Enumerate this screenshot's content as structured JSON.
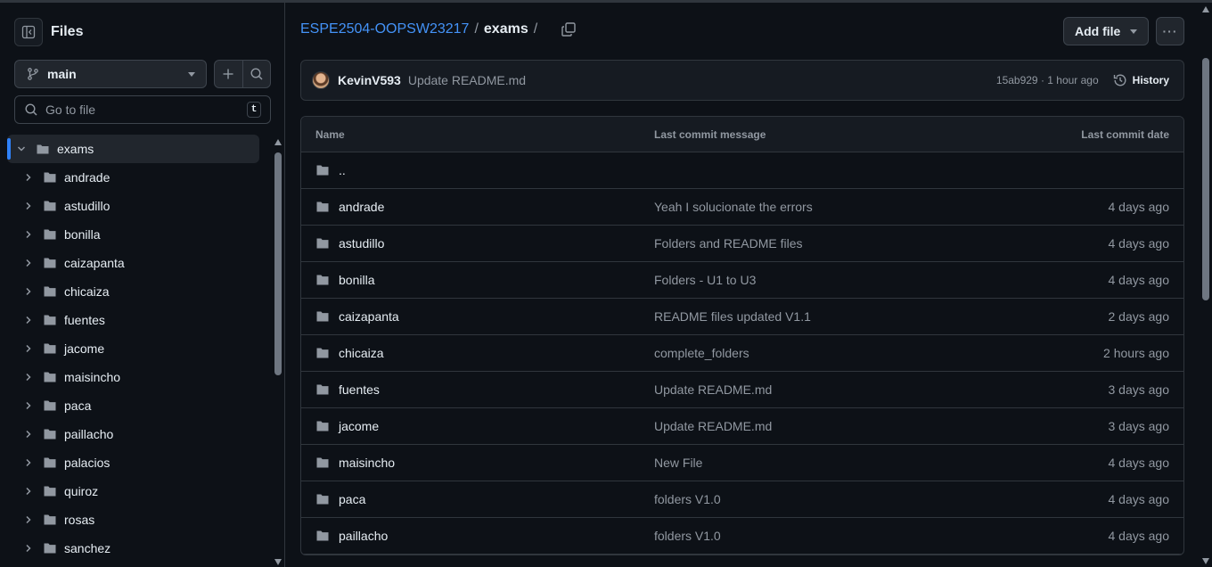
{
  "sidebar": {
    "title": "Files",
    "branch": "main",
    "goto_placeholder": "Go to file",
    "goto_shortcut": "t",
    "root_folder": "exams",
    "folders": [
      "andrade",
      "astudillo",
      "bonilla",
      "caizapanta",
      "chicaiza",
      "fuentes",
      "jacome",
      "maisincho",
      "paca",
      "paillacho",
      "palacios",
      "quiroz",
      "rosas",
      "sanchez"
    ]
  },
  "breadcrumb": {
    "repo": "ESPE2504-OOPSW23217",
    "separator": "/",
    "current": "exams",
    "trailing": "/"
  },
  "toolbar": {
    "add_file_label": "Add file",
    "more_label": "···"
  },
  "commit": {
    "author": "KevinV593",
    "message": "Update README.md",
    "meta": "15ab929 · 1 hour ago",
    "history_label": "History"
  },
  "table": {
    "headers": [
      "Name",
      "Last commit message",
      "Last commit date"
    ],
    "parent": "..",
    "rows": [
      {
        "name": "andrade",
        "message": "Yeah I solucionate the errors",
        "date": "4 days ago"
      },
      {
        "name": "astudillo",
        "message": "Folders and README files",
        "date": "4 days ago"
      },
      {
        "name": "bonilla",
        "message": "Folders - U1 to U3",
        "date": "4 days ago"
      },
      {
        "name": "caizapanta",
        "message": "README files updated V1.1",
        "date": "2 days ago"
      },
      {
        "name": "chicaiza",
        "message": "complete_folders",
        "date": "2 hours ago"
      },
      {
        "name": "fuentes",
        "message": "Update README.md",
        "date": "3 days ago"
      },
      {
        "name": "jacome",
        "message": "Update README.md",
        "date": "3 days ago"
      },
      {
        "name": "maisincho",
        "message": "New File",
        "date": "4 days ago"
      },
      {
        "name": "paca",
        "message": "folders V1.0",
        "date": "4 days ago"
      },
      {
        "name": "paillacho",
        "message": "folders V1.0",
        "date": "4 days ago"
      }
    ]
  },
  "colors": {
    "background": "#0d1117",
    "link": "#4493f8",
    "muted": "#9198a1",
    "border": "#30363d",
    "folder": "#9198a1"
  }
}
